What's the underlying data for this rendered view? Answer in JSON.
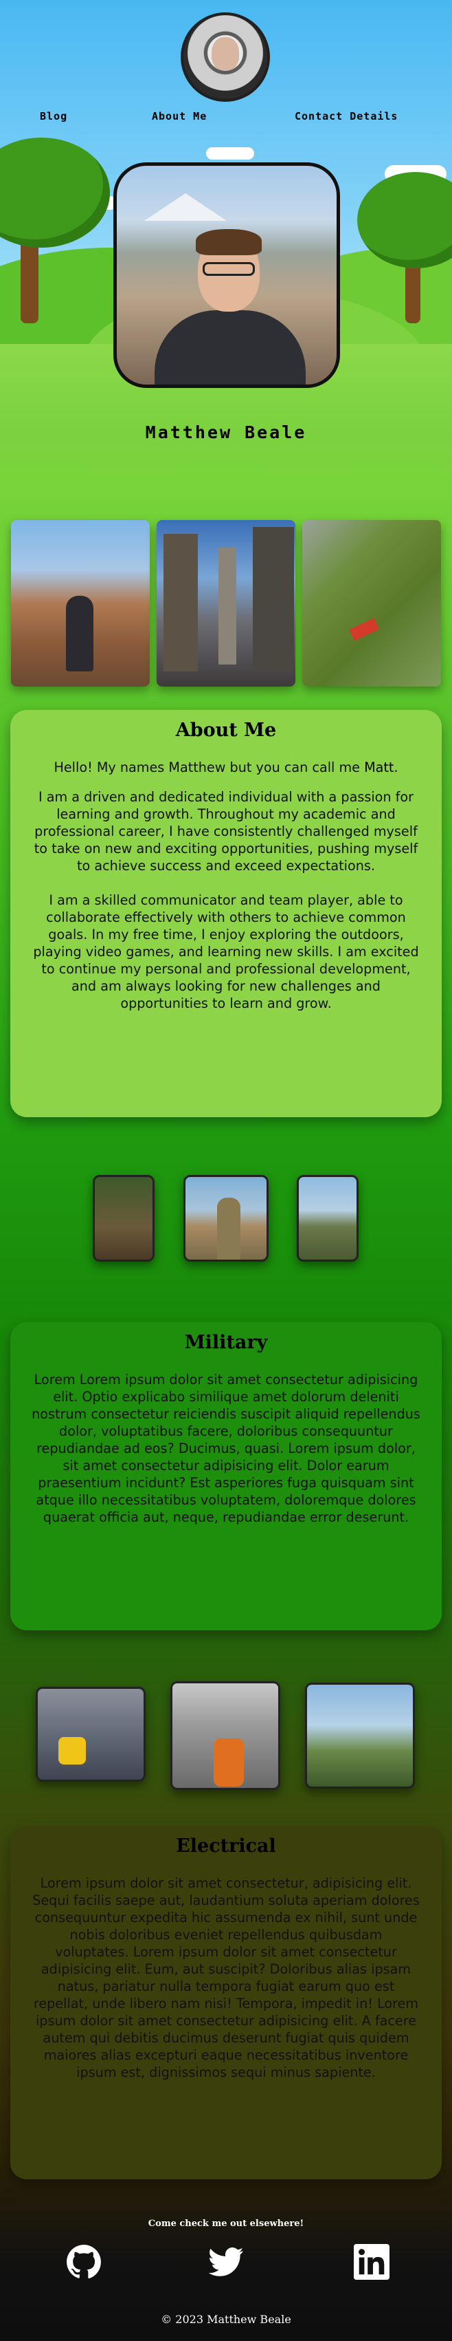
{
  "header": {
    "nav": [
      {
        "label": "Blog"
      },
      {
        "label": "About Me"
      },
      {
        "label": "Contact Details"
      }
    ]
  },
  "hero": {
    "name": "Matthew Beale"
  },
  "about": {
    "title": "About Me",
    "intro_before": "Hello! My names Matthew but you can call me ",
    "intro_highlight": "Matt",
    "intro_after": ".",
    "paragraph1": "I am a driven and dedicated individual with a passion for learning and growth. Throughout my academic and professional career, I have consistently challenged myself to take on new and exciting opportunities, pushing myself to achieve success and exceed expectations.",
    "paragraph2": "I am a skilled communicator and team player, able to collaborate effectively with others to achieve common goals. In my free time, I enjoy exploring the outdoors, playing video games, and learning new skills. I am excited to continue my personal and professional development, and am always looking for new challenges and opportunities to learn and grow."
  },
  "military": {
    "title": "Military",
    "text": "Lorem Lorem ipsum dolor sit amet consectetur adipisicing elit. Optio explicabo similique amet dolorum deleniti nostrum consectetur reiciendis suscipit aliquid repellendus dolor, voluptatibus facere, doloribus consequuntur repudiandae ad eos? Ducimus, quasi. Lorem ipsum dolor, sit amet consectetur adipisicing elit. Dolor earum praesentium incidunt? Est asperiores fuga quisquam sint atque illo necessitatibus voluptatem, doloremque dolores quaerat officia aut, neque, repudiandae error deserunt."
  },
  "electrical": {
    "title": "Electrical",
    "text": "Lorem ipsum dolor sit amet consectetur, adipisicing elit. Sequi facilis saepe aut, laudantium soluta aperiam dolores consequuntur expedita hic assumenda ex nihil, sunt unde nobis doloribus eveniet repellendus quibusdam voluptates. Lorem ipsum dolor sit amet consectetur adipisicing elit. Eum, aut suscipit? Doloribus alias ipsam natus, pariatur nulla tempora fugiat earum quo est repellat, unde libero nam nisi! Tempora, impedit in! Lorem ipsum dolor sit amet consectetur adipisicing elit. A facere autem qui debitis ducimus deserunt fugiat quis quidem maiores alias excepturi eaque necessitatibus inventore ipsum est, dignissimos sequi minus sapiente."
  },
  "footer": {
    "heading": "Come check me out elsewhere!",
    "socials": [
      {
        "icon": "github-icon"
      },
      {
        "icon": "twitter-icon"
      },
      {
        "icon": "linkedin-icon"
      }
    ],
    "copyright": "© 2023 Matthew Beale"
  },
  "colors": {
    "about_card": "#8dd449",
    "military_card": "#1e8f0c",
    "electrical_card": "#3b3f0c",
    "text_dark": "#111111",
    "footer_text": "#ffffff"
  }
}
